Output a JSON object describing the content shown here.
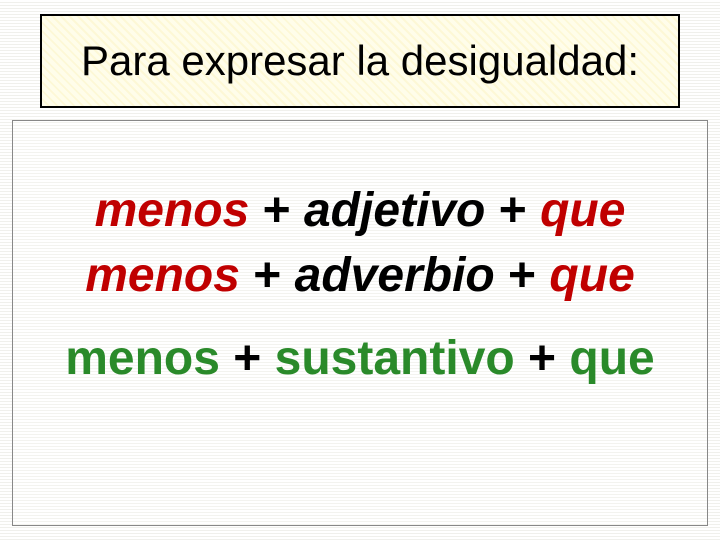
{
  "title": "Para expresar la desigualdad:",
  "line1": {
    "menos": "menos",
    "plus1": " + ",
    "mid": "adjetivo",
    "plus2": " + ",
    "que": "que"
  },
  "line2": {
    "menos": "menos",
    "plus1": " + ",
    "mid": "adverbio",
    "plus2": " + ",
    "que": "que"
  },
  "line3": {
    "menos": "menos",
    "plus1": " + ",
    "mid": "sustantivo",
    "plus2": " + ",
    "que": "que"
  }
}
